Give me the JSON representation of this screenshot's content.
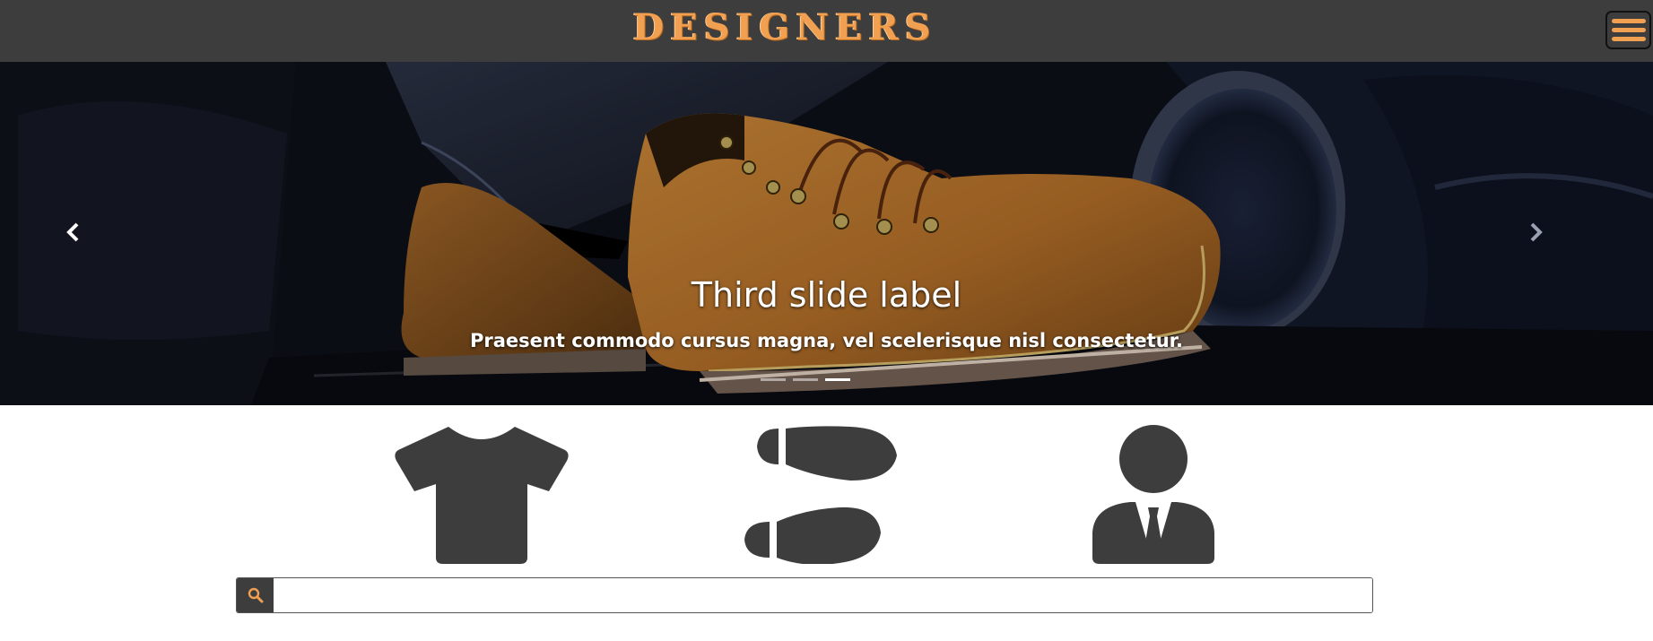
{
  "navbar": {
    "brand": "DESIGNERS",
    "brand_color": "#f0a050",
    "background": "#3d3d3d",
    "menu_icon": "hamburger-icon"
  },
  "carousel": {
    "slide_title": "Third slide label",
    "slide_text": "Praesent commodo cursus magna, vel scelerisque nisl consectetur.",
    "prev_icon": "chevron-left-icon",
    "next_icon": "chevron-right-icon",
    "indicators": 3,
    "active_indicator": 3
  },
  "categories": [
    {
      "icon": "tshirt-icon"
    },
    {
      "icon": "shoe-prints-icon"
    },
    {
      "icon": "businessman-icon"
    }
  ],
  "search": {
    "placeholder": "",
    "value": "",
    "icon": "search-icon",
    "icon_color": "#f0a050"
  }
}
